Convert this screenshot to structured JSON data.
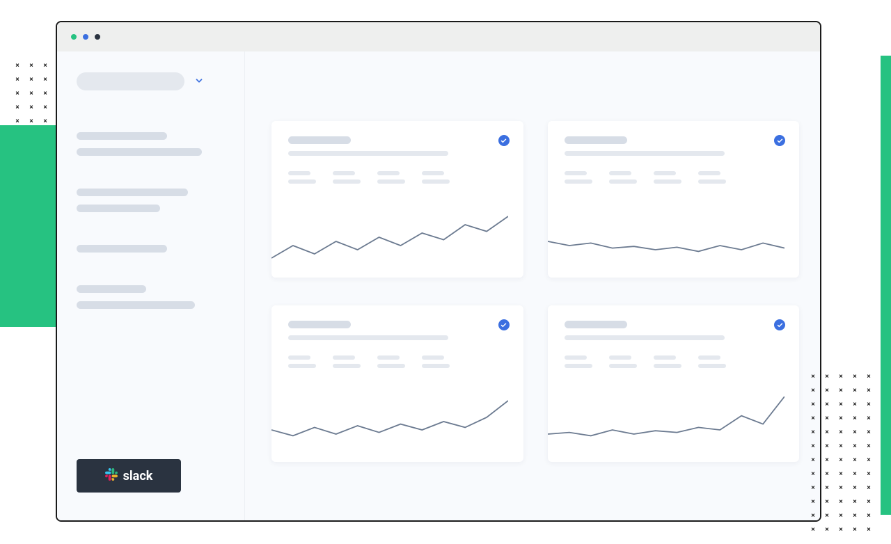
{
  "window": {
    "dots": [
      "green",
      "blue",
      "dark"
    ]
  },
  "sidebar": {
    "dropdown_icon": "chevron-down",
    "button_label": "slack"
  },
  "cards": [
    {
      "checked": true,
      "spark": [
        40,
        55,
        45,
        60,
        50,
        65,
        55,
        70,
        62,
        80,
        72,
        90
      ]
    },
    {
      "checked": true,
      "spark": [
        60,
        55,
        58,
        52,
        54,
        50,
        53,
        48,
        55,
        50,
        58,
        52
      ]
    },
    {
      "checked": true,
      "spark": [
        55,
        48,
        58,
        50,
        60,
        52,
        62,
        55,
        65,
        58,
        70,
        90
      ]
    },
    {
      "checked": true,
      "spark": [
        50,
        52,
        48,
        55,
        50,
        54,
        52,
        58,
        55,
        72,
        62,
        95
      ]
    }
  ],
  "colors": {
    "accent_blue": "#3b6fe0",
    "accent_green": "#26c281",
    "sparkline": "#6b7a90"
  }
}
